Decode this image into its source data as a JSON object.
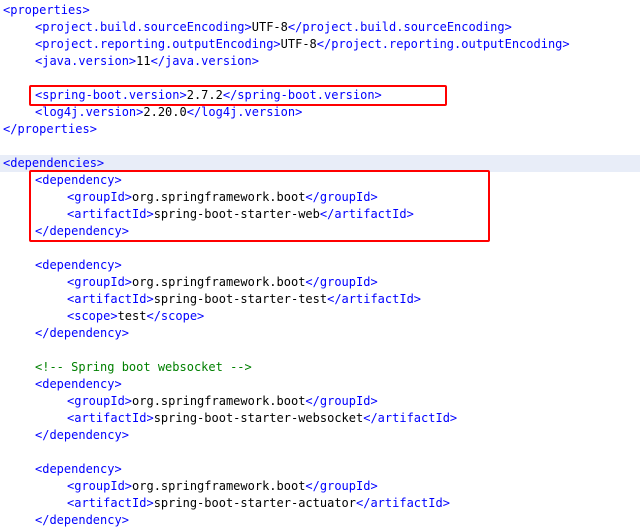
{
  "colors": {
    "tag": "#0000ff",
    "text": "#000000",
    "comment": "#008000",
    "highlight_box": "#ff0000",
    "current_line_bg": "#e8edf8"
  },
  "code_lines": [
    {
      "indent": 0,
      "tokens": [
        {
          "t": "tag",
          "v": "<properties>"
        }
      ]
    },
    {
      "indent": 1,
      "tokens": [
        {
          "t": "tag",
          "v": "<project.build.sourceEncoding>"
        },
        {
          "t": "text",
          "v": "UTF-8"
        },
        {
          "t": "tag",
          "v": "</project.build.sourceEncoding>"
        }
      ]
    },
    {
      "indent": 1,
      "tokens": [
        {
          "t": "tag",
          "v": "<project.reporting.outputEncoding>"
        },
        {
          "t": "text",
          "v": "UTF-8"
        },
        {
          "t": "tag",
          "v": "</project.reporting.outputEncoding>"
        }
      ]
    },
    {
      "indent": 1,
      "tokens": [
        {
          "t": "tag",
          "v": "<java.version>"
        },
        {
          "t": "text",
          "v": "11"
        },
        {
          "t": "tag",
          "v": "</java.version>"
        }
      ]
    },
    {
      "indent": 0,
      "tokens": []
    },
    {
      "indent": 1,
      "tokens": [
        {
          "t": "tag",
          "v": "<spring-boot.version>"
        },
        {
          "t": "text",
          "v": "2.7.2"
        },
        {
          "t": "tag",
          "v": "</spring-boot.version>"
        }
      ]
    },
    {
      "indent": 1,
      "tokens": [
        {
          "t": "tag",
          "v": "<log4j.version>"
        },
        {
          "t": "text",
          "v": "2.20.0"
        },
        {
          "t": "tag",
          "v": "</log4j.version>"
        }
      ]
    },
    {
      "indent": 0,
      "tokens": [
        {
          "t": "tag",
          "v": "</properties>"
        }
      ]
    },
    {
      "indent": 0,
      "tokens": []
    },
    {
      "indent": 0,
      "highlight": true,
      "tokens": [
        {
          "t": "tag",
          "v": "<dependencies>"
        }
      ]
    },
    {
      "indent": 1,
      "tokens": [
        {
          "t": "tag",
          "v": "<dependency>"
        }
      ]
    },
    {
      "indent": 2,
      "tokens": [
        {
          "t": "tag",
          "v": "<groupId>"
        },
        {
          "t": "text",
          "v": "org.springframework.boot"
        },
        {
          "t": "tag",
          "v": "</groupId>"
        }
      ]
    },
    {
      "indent": 2,
      "tokens": [
        {
          "t": "tag",
          "v": "<artifactId>"
        },
        {
          "t": "text",
          "v": "spring-boot-starter-web"
        },
        {
          "t": "tag",
          "v": "</artifactId>"
        }
      ]
    },
    {
      "indent": 1,
      "tokens": [
        {
          "t": "tag",
          "v": "</dependency>"
        }
      ]
    },
    {
      "indent": 0,
      "tokens": []
    },
    {
      "indent": 1,
      "tokens": [
        {
          "t": "tag",
          "v": "<dependency>"
        }
      ]
    },
    {
      "indent": 2,
      "tokens": [
        {
          "t": "tag",
          "v": "<groupId>"
        },
        {
          "t": "text",
          "v": "org.springframework.boot"
        },
        {
          "t": "tag",
          "v": "</groupId>"
        }
      ]
    },
    {
      "indent": 2,
      "tokens": [
        {
          "t": "tag",
          "v": "<artifactId>"
        },
        {
          "t": "text",
          "v": "spring-boot-starter-test"
        },
        {
          "t": "tag",
          "v": "</artifactId>"
        }
      ]
    },
    {
      "indent": 2,
      "tokens": [
        {
          "t": "tag",
          "v": "<scope>"
        },
        {
          "t": "text",
          "v": "test"
        },
        {
          "t": "tag",
          "v": "</scope>"
        }
      ]
    },
    {
      "indent": 1,
      "tokens": [
        {
          "t": "tag",
          "v": "</dependency>"
        }
      ]
    },
    {
      "indent": 0,
      "tokens": []
    },
    {
      "indent": 1,
      "tokens": [
        {
          "t": "comment",
          "v": "<!-- Spring boot websocket -->"
        }
      ]
    },
    {
      "indent": 1,
      "tokens": [
        {
          "t": "tag",
          "v": "<dependency>"
        }
      ]
    },
    {
      "indent": 2,
      "tokens": [
        {
          "t": "tag",
          "v": "<groupId>"
        },
        {
          "t": "text",
          "v": "org.springframework.boot"
        },
        {
          "t": "tag",
          "v": "</groupId>"
        }
      ]
    },
    {
      "indent": 2,
      "tokens": [
        {
          "t": "tag",
          "v": "<artifactId>"
        },
        {
          "t": "text",
          "v": "spring-boot-starter-websocket"
        },
        {
          "t": "tag",
          "v": "</artifactId>"
        }
      ]
    },
    {
      "indent": 1,
      "tokens": [
        {
          "t": "tag",
          "v": "</dependency>"
        }
      ]
    },
    {
      "indent": 0,
      "tokens": []
    },
    {
      "indent": 1,
      "tokens": [
        {
          "t": "tag",
          "v": "<dependency>"
        }
      ]
    },
    {
      "indent": 2,
      "tokens": [
        {
          "t": "tag",
          "v": "<groupId>"
        },
        {
          "t": "text",
          "v": "org.springframework.boot"
        },
        {
          "t": "tag",
          "v": "</groupId>"
        }
      ]
    },
    {
      "indent": 2,
      "tokens": [
        {
          "t": "tag",
          "v": "<artifactId>"
        },
        {
          "t": "text",
          "v": "spring-boot-starter-actuator"
        },
        {
          "t": "tag",
          "v": "</artifactId>"
        }
      ]
    },
    {
      "indent": 1,
      "tokens": [
        {
          "t": "tag",
          "v": "</dependency>"
        }
      ]
    }
  ],
  "annotations": [
    {
      "name": "spring-boot-version-highlight",
      "first_line": 5,
      "last_line": 5,
      "chars": 58
    },
    {
      "name": "spring-boot-starter-web-highlight",
      "first_line": 10,
      "last_line": 13,
      "chars": 64
    }
  ]
}
